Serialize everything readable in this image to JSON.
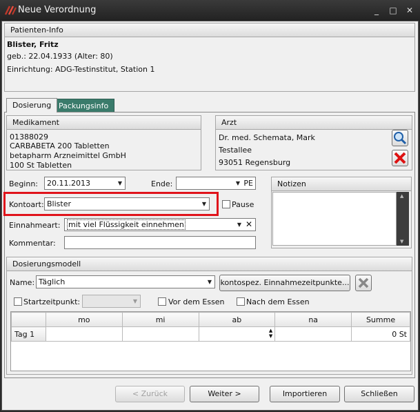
{
  "window": {
    "title": "Neue Verordnung",
    "controls": {
      "minimize": "_",
      "maximize": "□",
      "close": "✕"
    }
  },
  "patient": {
    "header": "Patienten-Info",
    "name": "Blister, Fritz",
    "birth": "geb.: 22.04.1933 (Alter: 80)",
    "facility": "Einrichtung: ADG-Testinstitut, Station 1"
  },
  "tabs": [
    {
      "label": "Dosierung",
      "active": true
    },
    {
      "label": "Packungsinfo",
      "active": false
    }
  ],
  "medikament": {
    "header": "Medikament",
    "lines": [
      "01388029",
      "CARBABETA 200 Tabletten",
      "betapharm Arzneimittel GmbH",
      "100 St Tabletten"
    ]
  },
  "arzt": {
    "header": "Arzt",
    "lines": [
      "Dr. med. Schemata, Mark",
      "Testallee",
      "93051  Regensburg"
    ],
    "search_icon": "magnifier-icon",
    "delete_icon": "red-x-icon"
  },
  "form": {
    "beginn_label": "Beginn:",
    "beginn_value": "20.11.2013",
    "ende_label": "Ende:",
    "ende_value": "",
    "ende_suffix": "PE",
    "kontoart_label": "Kontoart:",
    "kontoart_value": "Blister",
    "pause_label": "Pause",
    "einnahmeart_label": "Einnahmeart:",
    "einnahmeart_value": "mit viel Flüssigkeit einnehmen",
    "kommentar_label": "Kommentar:",
    "kommentar_value": ""
  },
  "notizen": {
    "header": "Notizen",
    "value": ""
  },
  "dosierungsmodell": {
    "header": "Dosierungsmodell",
    "name_label": "Name:",
    "name_value": "Täglich",
    "kontospez_button": "kontospez. Einnahmezeitpunkte...",
    "startzeitpunkt_label": "Startzeitpunkt:",
    "startzeitpunkt_value": "",
    "vor_essen_label": "Vor dem Essen",
    "nach_essen_label": "Nach dem Essen",
    "table": {
      "columns": [
        "",
        "mo",
        "mi",
        "ab",
        "na",
        "Summe"
      ],
      "rows": [
        {
          "day": "Tag 1",
          "mo": "",
          "mi": "",
          "ab": "",
          "na": "",
          "summe": "0 St"
        }
      ]
    }
  },
  "buttons": {
    "zurueck": "< Zurück",
    "weiter": "Weiter >",
    "importieren": "Importieren",
    "schliessen": "Schließen"
  },
  "colors": {
    "highlight": "#e0131b",
    "tab_inactive": "#3a7b6b"
  }
}
